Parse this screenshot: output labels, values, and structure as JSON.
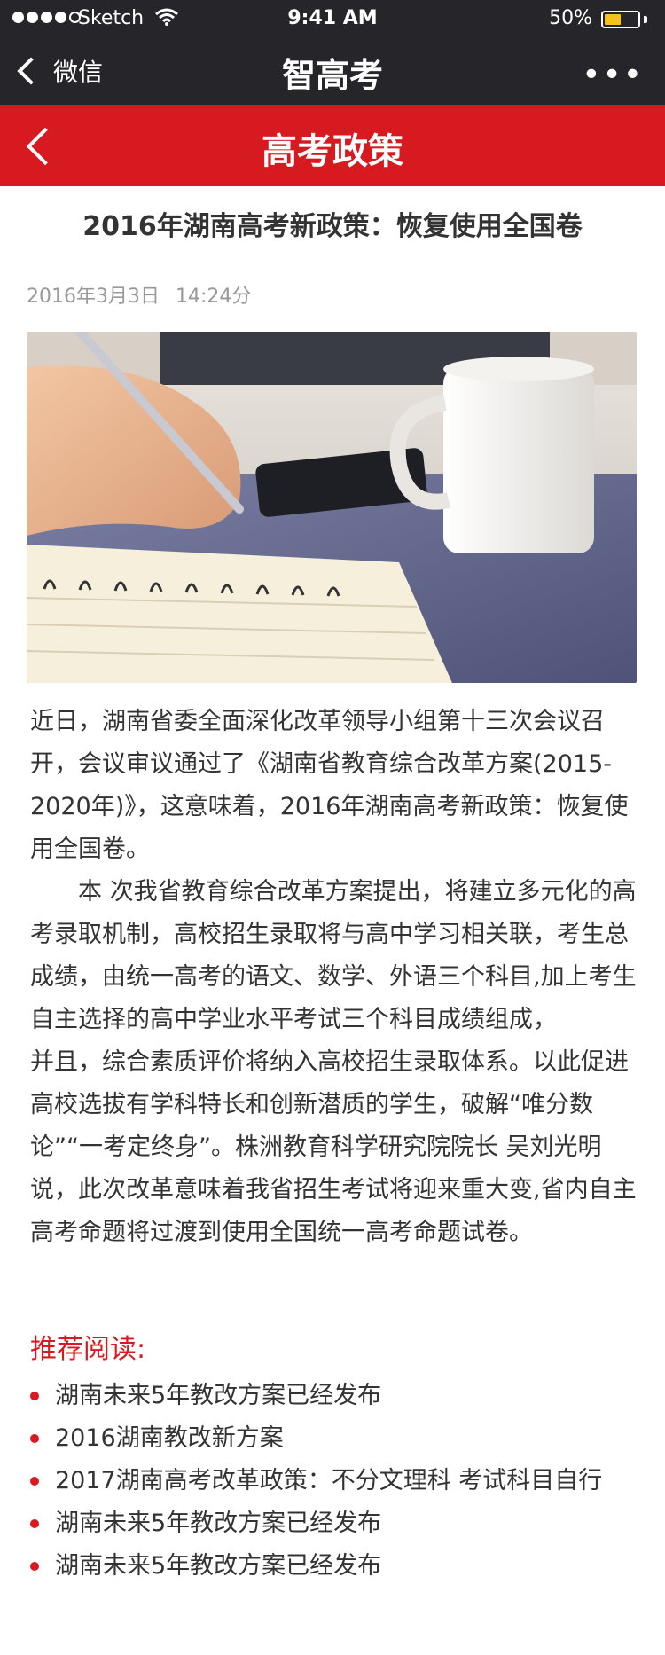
{
  "status_bar": {
    "carrier": "Sketch",
    "time": "9:41 AM",
    "battery_text": "50%",
    "battery_level": 0.5
  },
  "wechat_nav": {
    "back_label": "微信",
    "title": "智高考",
    "more_label": "•••"
  },
  "header": {
    "title": "高考政策"
  },
  "article": {
    "title": "2016年湖南高考新政策：恢复使用全国卷",
    "date": "2016年3月3日",
    "time": "14:24分",
    "paragraphs": [
      "近日，湖南省委全面深化改革领导小组第十三次会议召开，会议审议通过了《湖南省教育综合改革方案(2015-2020年)》，这意味着，2016年湖南高考新政策：恢复使用全国卷。",
      "本 次我省教育综合改革方案提出，将建立多元化的高考录取机制，高校招生录取将与高中学习相关联，考生总成绩，由统一高考的语文、数学、外语三个科目,加上考生自主选择的高中学业水平考试三个科目成绩组成，",
      "并且，综合素质评价将纳入高校招生录取体系。以此促进高校选拔有学科特长和创新潜质的学生，破解“唯分数论”“一考定终身”。株洲教育科学研究院院长 吴刘光明说，此次改革意味着我省招生考试将迎来重大变,省内自主高考命题将过渡到使用全国统一高考命题试卷。"
    ]
  },
  "recommend": {
    "title": "推荐阅读:",
    "items": [
      "湖南未来5年教改方案已经发布",
      "2016湖南教改新方案",
      "2017湖南高考改革政策：不分文理科 考试科目自行",
      "湖南未来5年教改方案已经发布",
      "湖南未来5年教改方案已经发布"
    ]
  },
  "colors": {
    "accent_red": "#d71920",
    "nav_dark": "#26262a",
    "battery_yellow": "#f6c21e"
  }
}
